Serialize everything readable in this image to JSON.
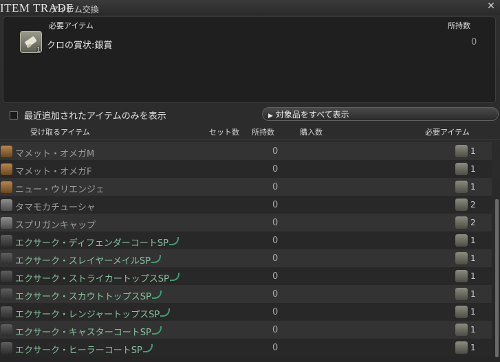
{
  "window": {
    "title": "ITEM TRADE",
    "subtitle": "アイテム交換",
    "close_glyph": "✕"
  },
  "required_panel": {
    "col_item": "必要アイテム",
    "col_owned": "所持数",
    "item_name": "クロの賞状:銀賞",
    "item_qty": "1",
    "owned": "0"
  },
  "filter": {
    "checkbox_label": "最近追加されたアイテムのみを表示",
    "show_all_label": "対象品をすべて表示"
  },
  "columns": {
    "receive": "受け取るアイテム",
    "sets": "セット数",
    "owned": "所持数",
    "purchase": "購入数",
    "required": "必要アイテム"
  },
  "rows": [
    {
      "name": "マメット・オメガM",
      "owned": "0",
      "req": "1",
      "icon": "minion-icon",
      "sp": false
    },
    {
      "name": "マメット・オメガF",
      "owned": "0",
      "req": "1",
      "icon": "minion-icon",
      "sp": false
    },
    {
      "name": "ニュー・ウリエンジェ",
      "owned": "0",
      "req": "1",
      "icon": "minion-icon",
      "sp": false
    },
    {
      "name": "タマモカチューシャ",
      "owned": "0",
      "req": "2",
      "icon": "headgear-icon",
      "sp": false
    },
    {
      "name": "スプリガンキャップ",
      "owned": "0",
      "req": "2",
      "icon": "headgear-icon",
      "sp": false
    },
    {
      "name": "エクサーク・ディフェンダーコートSP",
      "owned": "0",
      "req": "1",
      "icon": "body-armor-icon",
      "sp": true
    },
    {
      "name": "エクサーク・スレイヤーメイルSP",
      "owned": "0",
      "req": "1",
      "icon": "body-armor-icon",
      "sp": true
    },
    {
      "name": "エクサーク・ストライカートップスSP",
      "owned": "0",
      "req": "1",
      "icon": "body-armor-icon",
      "sp": true
    },
    {
      "name": "エクサーク・スカウトトップスSP",
      "owned": "0",
      "req": "1",
      "icon": "body-armor-icon",
      "sp": true
    },
    {
      "name": "エクサーク・レンジャートップスSP",
      "owned": "0",
      "req": "1",
      "icon": "body-armor-icon",
      "sp": true
    },
    {
      "name": "エクサーク・キャスターコートSP",
      "owned": "0",
      "req": "1",
      "icon": "body-armor-icon",
      "sp": true
    },
    {
      "name": "エクサーク・ヒーラーコートSP",
      "owned": "0",
      "req": "1",
      "icon": "body-armor-icon",
      "sp": true
    }
  ],
  "colors": {
    "accent_green": "#86c19d",
    "sp_mark": "#3e9e72"
  }
}
